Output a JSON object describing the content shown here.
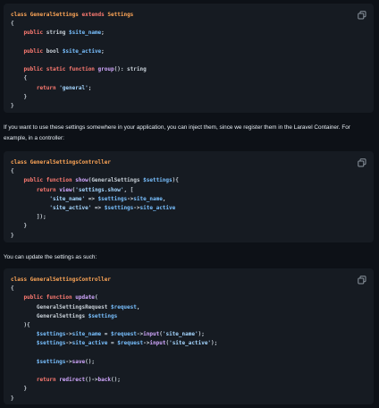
{
  "block1": {
    "lines": [
      [
        [
          "cls",
          "class GeneralSettings "
        ],
        [
          "kw",
          "extends "
        ],
        [
          "cls",
          "Settings"
        ]
      ],
      [
        [
          "txt",
          "{"
        ]
      ],
      [
        [
          "kw",
          "    public "
        ],
        [
          "txt",
          "string "
        ],
        [
          "var",
          "$site_name"
        ],
        [
          "txt",
          ";"
        ]
      ],
      [],
      [
        [
          "kw",
          "    public "
        ],
        [
          "txt",
          "bool "
        ],
        [
          "var",
          "$site_active"
        ],
        [
          "txt",
          ";"
        ]
      ],
      [],
      [
        [
          "kw",
          "    public static function "
        ],
        [
          "fn",
          "group"
        ],
        [
          "txt",
          "(): string"
        ]
      ],
      [
        [
          "txt",
          "    {"
        ]
      ],
      [
        [
          "kw",
          "        return "
        ],
        [
          "str",
          "'general'"
        ],
        [
          "txt",
          ";"
        ]
      ],
      [
        [
          "txt",
          "    }"
        ]
      ],
      [
        [
          "txt",
          "}"
        ]
      ]
    ]
  },
  "paragraph1": "If you want to use these settings somewhere in your application, you can inject them, since we register them in the Laravel Container. For example, in a controller:",
  "block2": {
    "lines": [
      [
        [
          "cls",
          "class GeneralSettingsController"
        ]
      ],
      [
        [
          "txt",
          "{"
        ]
      ],
      [
        [
          "kw",
          "    public function "
        ],
        [
          "fn",
          "show"
        ],
        [
          "txt",
          "(GeneralSettings "
        ],
        [
          "var",
          "$settings"
        ],
        [
          "txt",
          "){"
        ]
      ],
      [
        [
          "kw",
          "        return "
        ],
        [
          "fn",
          "view"
        ],
        [
          "txt",
          "("
        ],
        [
          "str",
          "'settings.show'"
        ],
        [
          "txt",
          ", ["
        ]
      ],
      [
        [
          "str",
          "            'site_name'"
        ],
        [
          "txt",
          " => "
        ],
        [
          "var",
          "$settings"
        ],
        [
          "txt",
          "->"
        ],
        [
          "var",
          "site_name"
        ],
        [
          "txt",
          ","
        ]
      ],
      [
        [
          "str",
          "            'site_active'"
        ],
        [
          "txt",
          " => "
        ],
        [
          "var",
          "$settings"
        ],
        [
          "txt",
          "->"
        ],
        [
          "var",
          "site_active"
        ]
      ],
      [
        [
          "txt",
          "        ]);"
        ]
      ],
      [
        [
          "txt",
          "    }"
        ]
      ],
      [
        [
          "txt",
          "}"
        ]
      ]
    ]
  },
  "paragraph2": "You can update the settings as such:",
  "block3": {
    "lines": [
      [
        [
          "cls",
          "class GeneralSettingsController"
        ]
      ],
      [
        [
          "txt",
          "{"
        ]
      ],
      [
        [
          "kw",
          "    public function "
        ],
        [
          "fn",
          "update"
        ],
        [
          "txt",
          "("
        ]
      ],
      [
        [
          "txt",
          "        GeneralSettingsRequest "
        ],
        [
          "var",
          "$request"
        ],
        [
          "txt",
          ","
        ]
      ],
      [
        [
          "txt",
          "        GeneralSettings "
        ],
        [
          "var",
          "$settings"
        ]
      ],
      [
        [
          "txt",
          "    ){"
        ]
      ],
      [
        [
          "var",
          "        $settings"
        ],
        [
          "txt",
          "->"
        ],
        [
          "var",
          "site_name"
        ],
        [
          "txt",
          " = "
        ],
        [
          "var",
          "$request"
        ],
        [
          "txt",
          "->"
        ],
        [
          "fn",
          "input"
        ],
        [
          "txt",
          "("
        ],
        [
          "str",
          "'site_name'"
        ],
        [
          "txt",
          ");"
        ]
      ],
      [
        [
          "var",
          "        $settings"
        ],
        [
          "txt",
          "->"
        ],
        [
          "var",
          "site_active"
        ],
        [
          "txt",
          " = "
        ],
        [
          "var",
          "$request"
        ],
        [
          "txt",
          "->"
        ],
        [
          "fn",
          "input"
        ],
        [
          "txt",
          "("
        ],
        [
          "str",
          "'site_active'"
        ],
        [
          "txt",
          ");"
        ]
      ],
      [],
      [
        [
          "var",
          "        $settings"
        ],
        [
          "txt",
          "->"
        ],
        [
          "fn",
          "save"
        ],
        [
          "txt",
          "();"
        ]
      ],
      [],
      [
        [
          "kw",
          "        return "
        ],
        [
          "fn",
          "redirect"
        ],
        [
          "txt",
          "()->"
        ],
        [
          "fn",
          "back"
        ],
        [
          "txt",
          "();"
        ]
      ],
      [
        [
          "txt",
          "    }"
        ]
      ],
      [
        [
          "txt",
          "}"
        ]
      ]
    ]
  }
}
